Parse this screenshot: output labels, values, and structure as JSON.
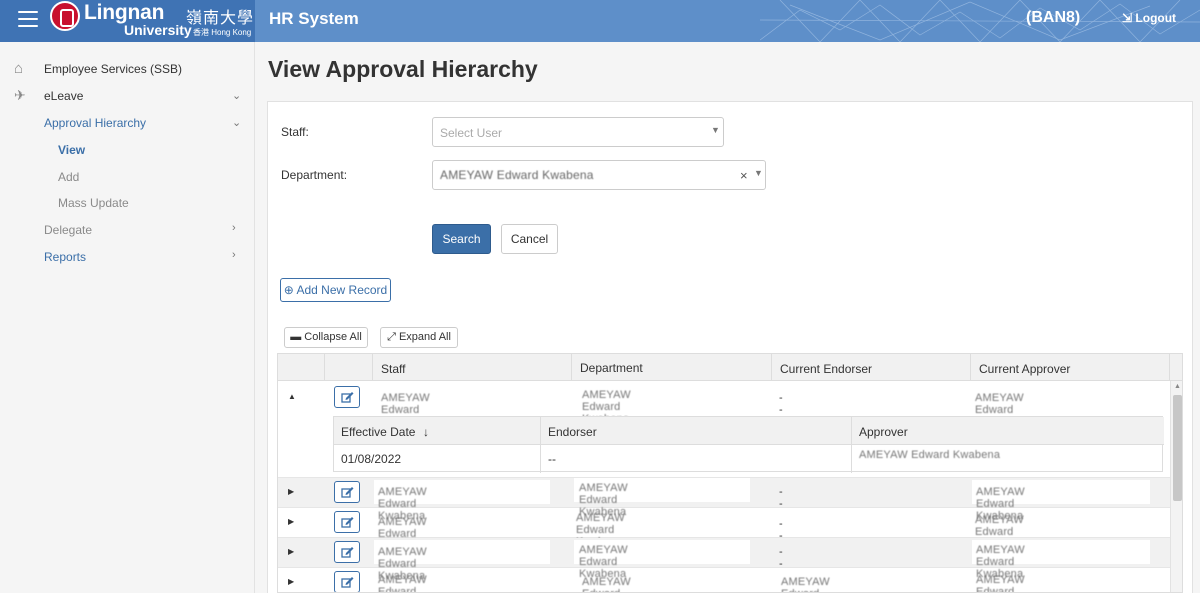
{
  "header": {
    "logo_en": "Lingnan",
    "logo_cn": "嶺南大學",
    "logo_uni": "University",
    "logo_hk": "香港 Hong Kong",
    "app_title": "HR System",
    "user_code": "(BAN8)",
    "logout_label": "Logout"
  },
  "sidebar": {
    "items": [
      {
        "label": "Employee Services (SSB)",
        "icon": "home-icon"
      },
      {
        "label": "eLeave",
        "icon": "paper-plane-icon"
      },
      {
        "label": "Approval Hierarchy"
      },
      {
        "label": "View"
      },
      {
        "label": "Add"
      },
      {
        "label": "Mass Update"
      },
      {
        "label": "Delegate"
      },
      {
        "label": "Reports"
      }
    ]
  },
  "page": {
    "title": "View Approval Hierarchy"
  },
  "form": {
    "staff_label": "Staff:",
    "staff_placeholder": "Select User",
    "department_label": "Department:",
    "department_value": "AMEYAW Edward Kwabena",
    "search_label": "Search",
    "cancel_label": "Cancel"
  },
  "toolbar": {
    "add_label": "Add New Record",
    "collapse_label": "Collapse All",
    "expand_label": "Expand All"
  },
  "grid": {
    "columns": [
      "Staff",
      "Department",
      "Current Endorser",
      "Current Approver"
    ],
    "rows": [
      {
        "staff": "AMEYAW Edward Kwabena",
        "department": "AMEYAW Edward Kwabena",
        "endorser": "--",
        "approver": "AMEYAW Edward Kwabena"
      },
      {
        "staff": "AMEYAW Edward Kwabena",
        "department": "AMEYAW Edward Kwabena",
        "endorser": "--",
        "approver": "AMEYAW Edward Kwabena"
      },
      {
        "staff": "AMEYAW Edward Kwabena",
        "department": "AMEYAW Edward Kwabena",
        "endorser": "--",
        "approver": "AMEYAW Edward Kwabena"
      },
      {
        "staff": "AMEYAW Edward Kwabena",
        "department": "AMEYAW Edward Kwabena",
        "endorser": "--",
        "approver": "AMEYAW Edward Kwabena"
      },
      {
        "staff": "AMEYAW Edward Kwabena",
        "department": "AMEYAW Edward Kwabena",
        "endorser": "AMEYAW Edward Kwabena",
        "approver": "AMEYAW Edward Kwabena"
      }
    ],
    "detail": {
      "columns": [
        "Effective Date",
        "Endorser",
        "Approver"
      ],
      "row": {
        "effective_date": "01/08/2022",
        "endorser": "--",
        "approver": "AMEYAW Edward Kwabena"
      }
    }
  }
}
